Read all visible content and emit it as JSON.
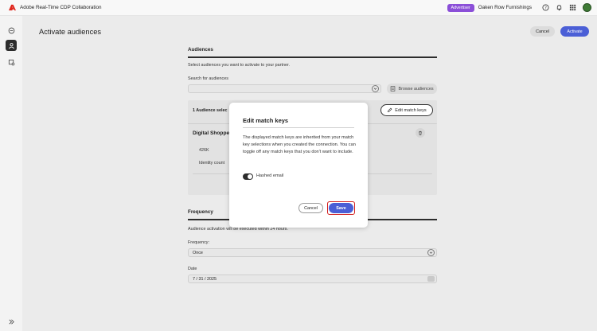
{
  "header": {
    "app_title": "Adobe Real-Time CDP Collaboration",
    "badge": "Advertiser",
    "org_name": "Oaken Row Furnishings",
    "icons": [
      "help-icon",
      "bell-icon",
      "apps-grid-icon",
      "avatar"
    ]
  },
  "rail": {
    "items": [
      "home-icon",
      "audiences-icon",
      "settings-icon"
    ],
    "expand": "expand-icon"
  },
  "page": {
    "title": "Activate audiences",
    "cancel_label": "Cancel",
    "activate_label": "Activate"
  },
  "audiences": {
    "section_title": "Audiences",
    "description": "Select audiences you want to activate to your partner.",
    "search_label": "Search for audiences",
    "browse_label": "Browse audiences",
    "selected_count": "1 Audience selec",
    "edit_match_keys_label": "Edit match keys",
    "audience_name": "Digital Shopper",
    "size_value": "426K",
    "size_label": "Identity count"
  },
  "frequency": {
    "section_title": "Frequency",
    "note": "Audience activation will be executed within 24 hours.",
    "frequency_label": "Frequency:",
    "frequency_value": "Once",
    "date_label": "Date",
    "date_value": "7 / 31 / 2025"
  },
  "dialog": {
    "title": "Edit match keys",
    "body": "The displayed match keys are inherited from your match key selections when you created the connection. You can toggle off any match keys that you don't want to include.",
    "toggle_label": "Hashed email",
    "toggle_on": true,
    "cancel_label": "Cancel",
    "save_label": "Save"
  },
  "colors": {
    "accent": "#4b5fd6",
    "badge": "#8b4fd8",
    "highlight": "#d21f1f"
  }
}
